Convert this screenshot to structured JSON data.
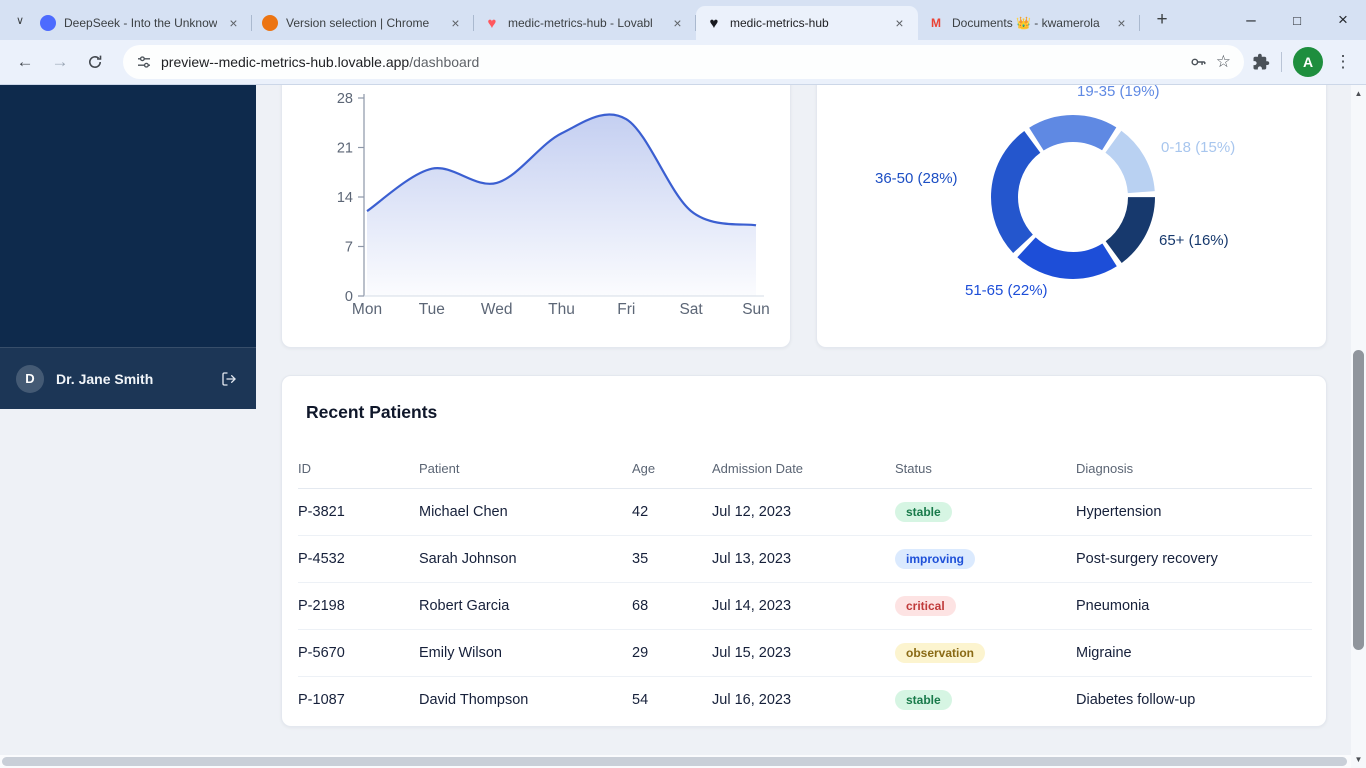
{
  "browser": {
    "tabs": [
      {
        "title": "DeepSeek - Into the Unknow",
        "icon": "deepseek-whale-icon"
      },
      {
        "title": "Version selection | Chrome",
        "icon": "version-selection-icon"
      },
      {
        "title": "medic-metrics-hub - Lovabl",
        "icon": "lovable-heart-icon"
      },
      {
        "title": "medic-metrics-hub",
        "icon": "black-heart-icon",
        "active": true
      },
      {
        "title": "Documents 👑 - kwamerola",
        "icon": "gmail-icon"
      }
    ],
    "omnibox": {
      "domain": "preview--medic-metrics-hub.lovable.app",
      "path": "/dashboard"
    },
    "profile_initial": "A"
  },
  "sidebar": {
    "user_initial": "D",
    "user_name": "Dr. Jane Smith"
  },
  "patients": {
    "title": "Recent Patients",
    "columns": [
      "ID",
      "Patient",
      "Age",
      "Admission Date",
      "Status",
      "Diagnosis"
    ],
    "rows": [
      {
        "id": "P-3821",
        "patient": "Michael Chen",
        "age": "42",
        "admission": "Jul 12, 2023",
        "status": "stable",
        "diagnosis": "Hypertension"
      },
      {
        "id": "P-4532",
        "patient": "Sarah Johnson",
        "age": "35",
        "admission": "Jul 13, 2023",
        "status": "improving",
        "diagnosis": "Post-surgery recovery"
      },
      {
        "id": "P-2198",
        "patient": "Robert Garcia",
        "age": "68",
        "admission": "Jul 14, 2023",
        "status": "critical",
        "diagnosis": "Pneumonia"
      },
      {
        "id": "P-5670",
        "patient": "Emily Wilson",
        "age": "29",
        "admission": "Jul 15, 2023",
        "status": "observation",
        "diagnosis": "Migraine"
      },
      {
        "id": "P-1087",
        "patient": "David Thompson",
        "age": "54",
        "admission": "Jul 16, 2023",
        "status": "stable",
        "diagnosis": "Diabetes follow-up"
      }
    ],
    "status_colors": {
      "stable": {
        "bg": "#d6f5e3",
        "fg": "#187a4a"
      },
      "improving": {
        "bg": "#dbeafe",
        "fg": "#1e50d8"
      },
      "critical": {
        "bg": "#fde3e3",
        "fg": "#c03a3a"
      },
      "observation": {
        "bg": "#fcf4cf",
        "fg": "#8a6a15"
      }
    }
  },
  "chart_data": [
    {
      "type": "area",
      "x": [
        "Mon",
        "Tue",
        "Wed",
        "Thu",
        "Fri",
        "Sat",
        "Sun"
      ],
      "values": [
        12,
        18,
        16,
        23,
        25,
        12,
        10
      ],
      "ylim": [
        0,
        28
      ],
      "y_ticks": [
        0,
        7,
        14,
        21,
        28
      ],
      "line_color": "#3b5fd1",
      "grid": false,
      "legend": false
    },
    {
      "type": "pie",
      "donut": true,
      "start_angle_deg": -2,
      "segments": [
        {
          "label": "0-18 (15%)",
          "value": 15,
          "color": "#b9d1f2",
          "label_color": "#a8c6ee"
        },
        {
          "label": "19-35 (19%)",
          "value": 19,
          "color": "#5f89e3",
          "label_color": "#5f89e3"
        },
        {
          "label": "36-50 (28%)",
          "value": 28,
          "color": "#2456cd",
          "label_color": "#1d4fc4"
        },
        {
          "label": "51-65 (22%)",
          "value": 22,
          "color": "#1d4ed8",
          "label_color": "#1d4ed8"
        },
        {
          "label": "65+ (16%)",
          "value": 16,
          "color": "#17396d",
          "label_color": "#17396d"
        }
      ],
      "legend": false
    }
  ]
}
